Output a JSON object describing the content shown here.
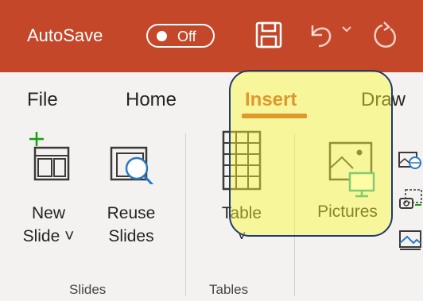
{
  "titlebar": {
    "autosave_label": "AutoSave",
    "autosave_state": "Off",
    "icons": [
      "save-icon",
      "undo-icon",
      "redo-icon"
    ]
  },
  "tabs": [
    {
      "label": "File",
      "active": false
    },
    {
      "label": "Home",
      "active": false
    },
    {
      "label": "Insert",
      "active": true
    },
    {
      "label": "Draw",
      "active": false
    }
  ],
  "ribbon": {
    "buttons": {
      "new_slide": {
        "line1": "New",
        "line2": "Slide ˅"
      },
      "reuse_slides": {
        "line1": "Reuse",
        "line2": "Slides"
      },
      "table": {
        "line1": "Table",
        "line2": "˅"
      },
      "pictures": {
        "line1": "Pictures"
      }
    },
    "groups": {
      "slides": "Slides",
      "tables": "Tables"
    }
  },
  "colors": {
    "titlebar": "#c4472a",
    "accent": "#c4472a",
    "highlight_fill": "#fffb32",
    "highlight_border": "#1e3a6e"
  }
}
